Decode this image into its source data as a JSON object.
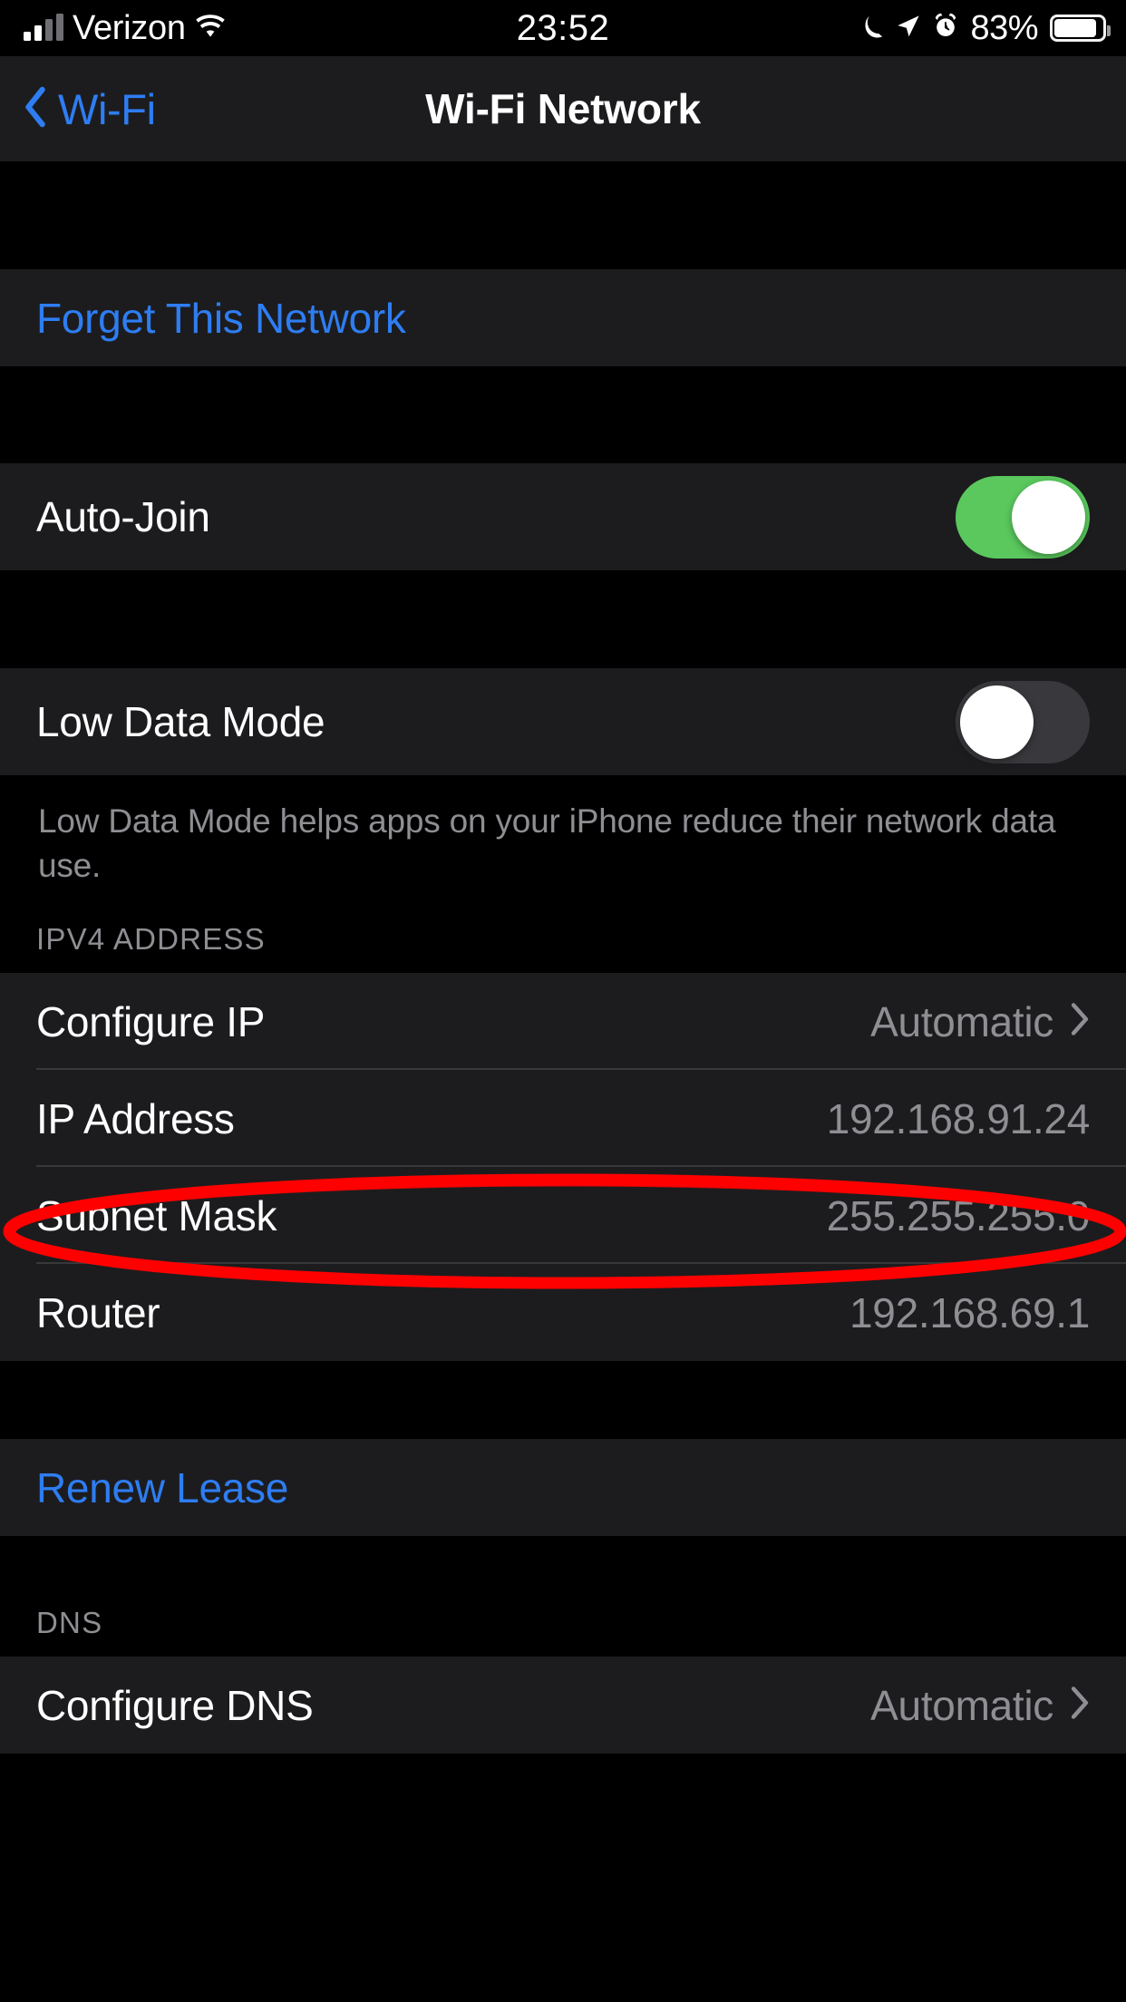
{
  "status_bar": {
    "carrier": "Verizon",
    "time": "23:52",
    "battery_percent": "83%",
    "battery_level": 83,
    "icons": [
      "signal-bars-icon",
      "wifi-icon",
      "moon-icon",
      "location-arrow-icon",
      "alarm-clock-icon",
      "battery-icon"
    ]
  },
  "nav_bar": {
    "back_label": "Wi-Fi",
    "title": "Wi-Fi Network"
  },
  "sections": {
    "forget": {
      "label": "Forget This Network"
    },
    "auto_join": {
      "label": "Auto-Join",
      "value": "on"
    },
    "low_data": {
      "label": "Low Data Mode",
      "value": "off",
      "footer": "Low Data Mode helps apps on your iPhone reduce their network data use."
    },
    "ipv4": {
      "header": "IPV4 ADDRESS",
      "rows": [
        {
          "label": "Configure IP",
          "value": "Automatic",
          "accessory": "chevron-right-icon"
        },
        {
          "label": "IP Address",
          "value": "192.168.91.24",
          "accessory": ""
        },
        {
          "label": "Subnet Mask",
          "value": "255.255.255.0",
          "accessory": ""
        },
        {
          "label": "Router",
          "value": "192.168.69.1",
          "accessory": ""
        }
      ]
    },
    "renew": {
      "label": "Renew Lease"
    },
    "dns": {
      "header": "DNS",
      "rows": [
        {
          "label": "Configure DNS",
          "value": "Automatic",
          "accessory": "chevron-right-icon"
        }
      ]
    }
  },
  "annotation": {
    "shape": "ellipse",
    "color": "#FF0000",
    "targets": "IP Address row"
  },
  "colors": {
    "background": "#000000",
    "cell": "#1C1C1E",
    "separator": "#38383A",
    "accent_blue": "#2E7DF2",
    "secondary_text": "#8E8E93",
    "toggle_on": "#5AC85D",
    "toggle_off": "#39393D",
    "annotation_red": "#FF0000"
  }
}
